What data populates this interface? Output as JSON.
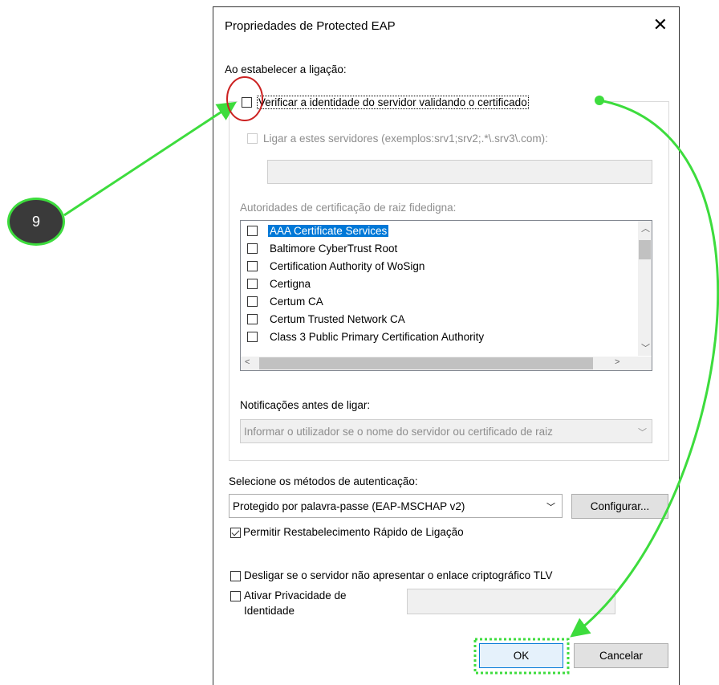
{
  "dialog": {
    "title": "Propriedades de Protected EAP",
    "close_glyph": "✕"
  },
  "connect": {
    "heading": "Ao estabelecer a ligação:",
    "verify_checkbox": "Verificar a identidade do servidor validando o certificado",
    "verify_checked": false,
    "connect_servers_checkbox": "Ligar a estes servidores (exemplos:srv1;srv2;.*\\.srv3\\.com):",
    "servers_input_value": ""
  },
  "trusted_ca": {
    "label": "Autoridades de certificação de raiz fidedigna:",
    "items": [
      {
        "label": "AAA Certificate Services",
        "checked": false,
        "selected": true
      },
      {
        "label": "Baltimore CyberTrust Root",
        "checked": false,
        "selected": false
      },
      {
        "label": "Certification Authority of WoSign",
        "checked": false,
        "selected": false
      },
      {
        "label": "Certigna",
        "checked": false,
        "selected": false
      },
      {
        "label": "Certum CA",
        "checked": false,
        "selected": false
      },
      {
        "label": "Certum Trusted Network CA",
        "checked": false,
        "selected": false
      },
      {
        "label": "Class 3 Public Primary Certification Authority",
        "checked": false,
        "selected": false
      }
    ]
  },
  "notifications": {
    "label": "Notificações antes de ligar:",
    "selected": "Informar o utilizador se o nome do servidor ou certificado de raiz"
  },
  "auth": {
    "label": "Selecione os métodos de autenticação:",
    "method_selected": "Protegido por palavra-passe (EAP-MSCHAP v2)",
    "configure_button": "Configurar...",
    "fast_reconnect": "Permitir Restabelecimento Rápido de Ligação",
    "fast_reconnect_checked": true,
    "disconnect_tlv": "Desligar se o servidor não apresentar o enlace criptográfico TLV",
    "disconnect_tlv_checked": false,
    "identity_privacy_line1": "Ativar Privacidade de",
    "identity_privacy_line2": "Identidade",
    "identity_privacy_checked": false,
    "identity_value": ""
  },
  "buttons": {
    "ok": "OK",
    "cancel": "Cancelar"
  },
  "annotation": {
    "step_number": "9",
    "badge_color": "#3a3a3a",
    "accent_color": "#3ddc3d",
    "highlight_circle_color": "#cc2222"
  }
}
